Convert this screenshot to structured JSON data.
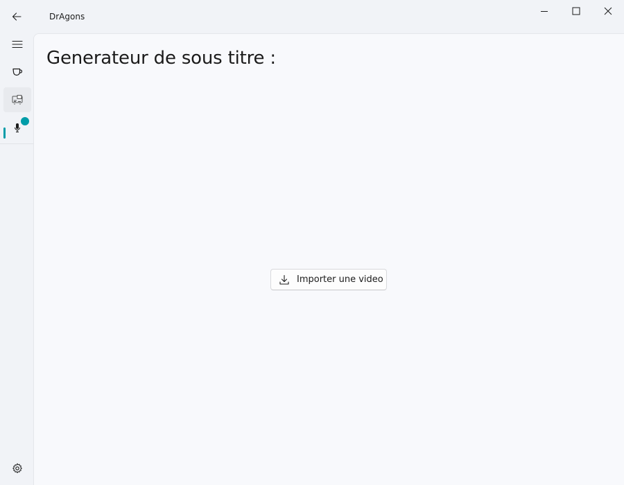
{
  "app": {
    "title": "DrAgons"
  },
  "window_controls": {
    "minimize": "minimize-icon",
    "maximize": "maximize-icon",
    "close": "close-icon"
  },
  "nav": {
    "items": [
      {
        "icon": "hamburger-menu-icon",
        "selected": false
      },
      {
        "icon": "cup-icon",
        "selected": false
      },
      {
        "icon": "video-subtitle-icon",
        "selected": true
      },
      {
        "icon": "microphone-icon",
        "selected": false,
        "badge": true
      }
    ],
    "footer_icon": "settings-gear-icon"
  },
  "page": {
    "title": "Generateur de sous titre :",
    "import_button": {
      "label": "Importer une video",
      "icon": "download-icon"
    }
  },
  "colors": {
    "accent": "#009ca8",
    "background": "#f1f3f7",
    "content_background": "#f8f9fc"
  }
}
